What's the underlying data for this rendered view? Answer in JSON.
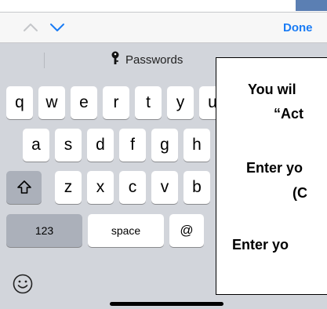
{
  "accessory_bar": {
    "prev_icon": "chevron-up-icon",
    "next_icon": "chevron-down-icon",
    "done_label": "Done",
    "accent": "#1a7cf5"
  },
  "suggestion_bar": {
    "passwords_label": "Passwords",
    "key_icon": "key-icon"
  },
  "keyboard": {
    "row1": [
      "q",
      "w",
      "e",
      "r",
      "t",
      "y",
      "u"
    ],
    "row2": [
      "a",
      "s",
      "d",
      "f",
      "g",
      "h"
    ],
    "row3": [
      "z",
      "x",
      "c",
      "v",
      "b"
    ],
    "shift_icon": "shift-arrow-icon",
    "numbers_label": "123",
    "space_label": "space",
    "at_label": "@",
    "emoji_icon": "emoji-smiley-icon"
  },
  "overlay": {
    "lines": [
      "You wil",
      "“Act",
      "Enter yo",
      "(C",
      "Enter yo"
    ]
  }
}
